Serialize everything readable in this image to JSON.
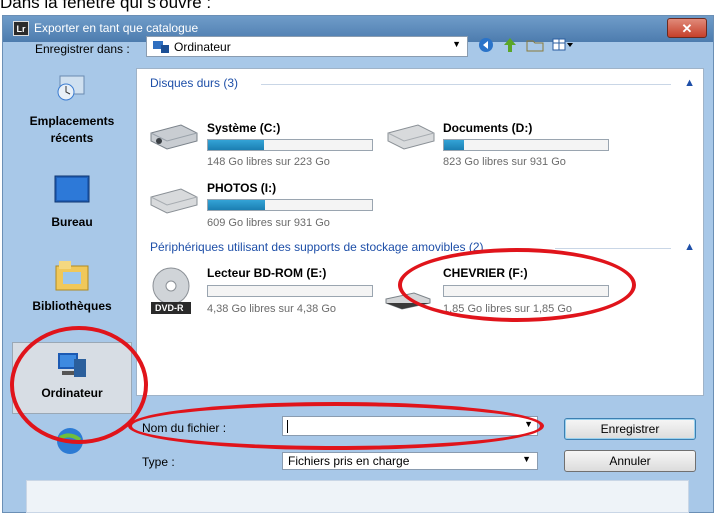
{
  "caption": "Dans la fenêtre qui s'ouvre :",
  "window": {
    "title": "Exporter en tant que catalogue",
    "app_icon": "Lr",
    "close_label": "✕"
  },
  "location": {
    "label": "Enregistrer dans :",
    "value": "Ordinateur"
  },
  "places": [
    {
      "label": "Emplacements récents",
      "icon": "recent-places-icon"
    },
    {
      "label": "Bureau",
      "icon": "desktop-icon"
    },
    {
      "label": "Bibliothèques",
      "icon": "libraries-icon"
    },
    {
      "label": "Ordinateur",
      "icon": "computer-icon",
      "selected": true
    }
  ],
  "groups": {
    "hard_disks": {
      "title": "Disques durs (3)",
      "drives": [
        {
          "name": "Système (C:)",
          "space": "148 Go libres sur 223 Go",
          "used_fraction": 0.34
        },
        {
          "name": "Documents (D:)",
          "space": "823 Go libres sur 931 Go",
          "used_fraction": 0.12
        },
        {
          "name": "PHOTOS (I:)",
          "space": "609 Go libres sur 931 Go",
          "used_fraction": 0.35
        }
      ]
    },
    "removable": {
      "title": "Périphériques utilisant des supports de stockage amovibles (2)",
      "drives": [
        {
          "name": "Lecteur BD-ROM (E:)",
          "space": "4,38 Go libres sur 4,38 Go",
          "used_fraction": 0,
          "badge": "DVD-R"
        },
        {
          "name": "CHEVRIER (F:)",
          "space": "1,85 Go libres sur 1,85 Go",
          "used_fraction": 0
        }
      ]
    }
  },
  "form": {
    "filename_label": "Nom du fichier :",
    "filename_value": "",
    "type_label": "Type :",
    "type_value": "Fichiers pris en charge",
    "save_button": "Enregistrer",
    "cancel_button": "Annuler"
  },
  "colors": {
    "annotation": "#e0141b",
    "drive_fill": "#1b7fb2",
    "group_header": "#1e4fa8"
  }
}
